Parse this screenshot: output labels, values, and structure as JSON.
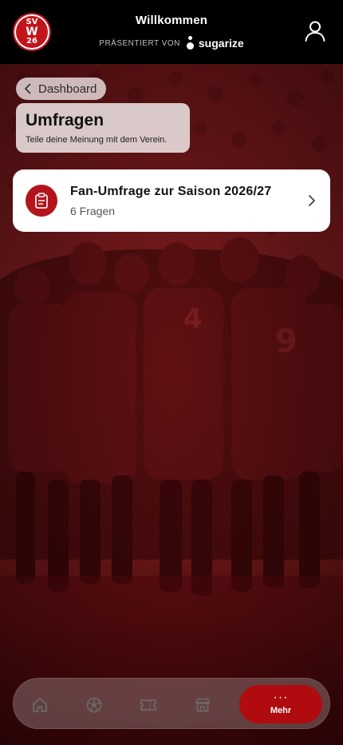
{
  "header": {
    "title": "Willkommen",
    "presented_by": "PRÄSENTIERT VON",
    "sponsor": "sugarize",
    "logo": {
      "top_text": "SV",
      "letter": "W",
      "number": "26"
    }
  },
  "back": {
    "label": "Dashboard"
  },
  "page": {
    "title": "Umfragen",
    "subtitle": "Teile deine Meinung mit dem Verein."
  },
  "surveys": [
    {
      "title": "Fan-Umfrage zur Saison 2026/27",
      "subtitle": "6 Fragen",
      "icon": "clipboard-icon"
    }
  ],
  "nav": {
    "items": [
      {
        "name": "home",
        "icon": "home-icon"
      },
      {
        "name": "matches",
        "icon": "soccer-ball-icon"
      },
      {
        "name": "tickets",
        "icon": "ticket-icon"
      },
      {
        "name": "shop",
        "icon": "store-icon"
      }
    ],
    "more": {
      "dots": "···",
      "label": "Mehr",
      "active": true
    }
  },
  "colors": {
    "brand_red": "#b00b0f",
    "icon_red": "#b3141b",
    "header_bg": "#000000"
  }
}
